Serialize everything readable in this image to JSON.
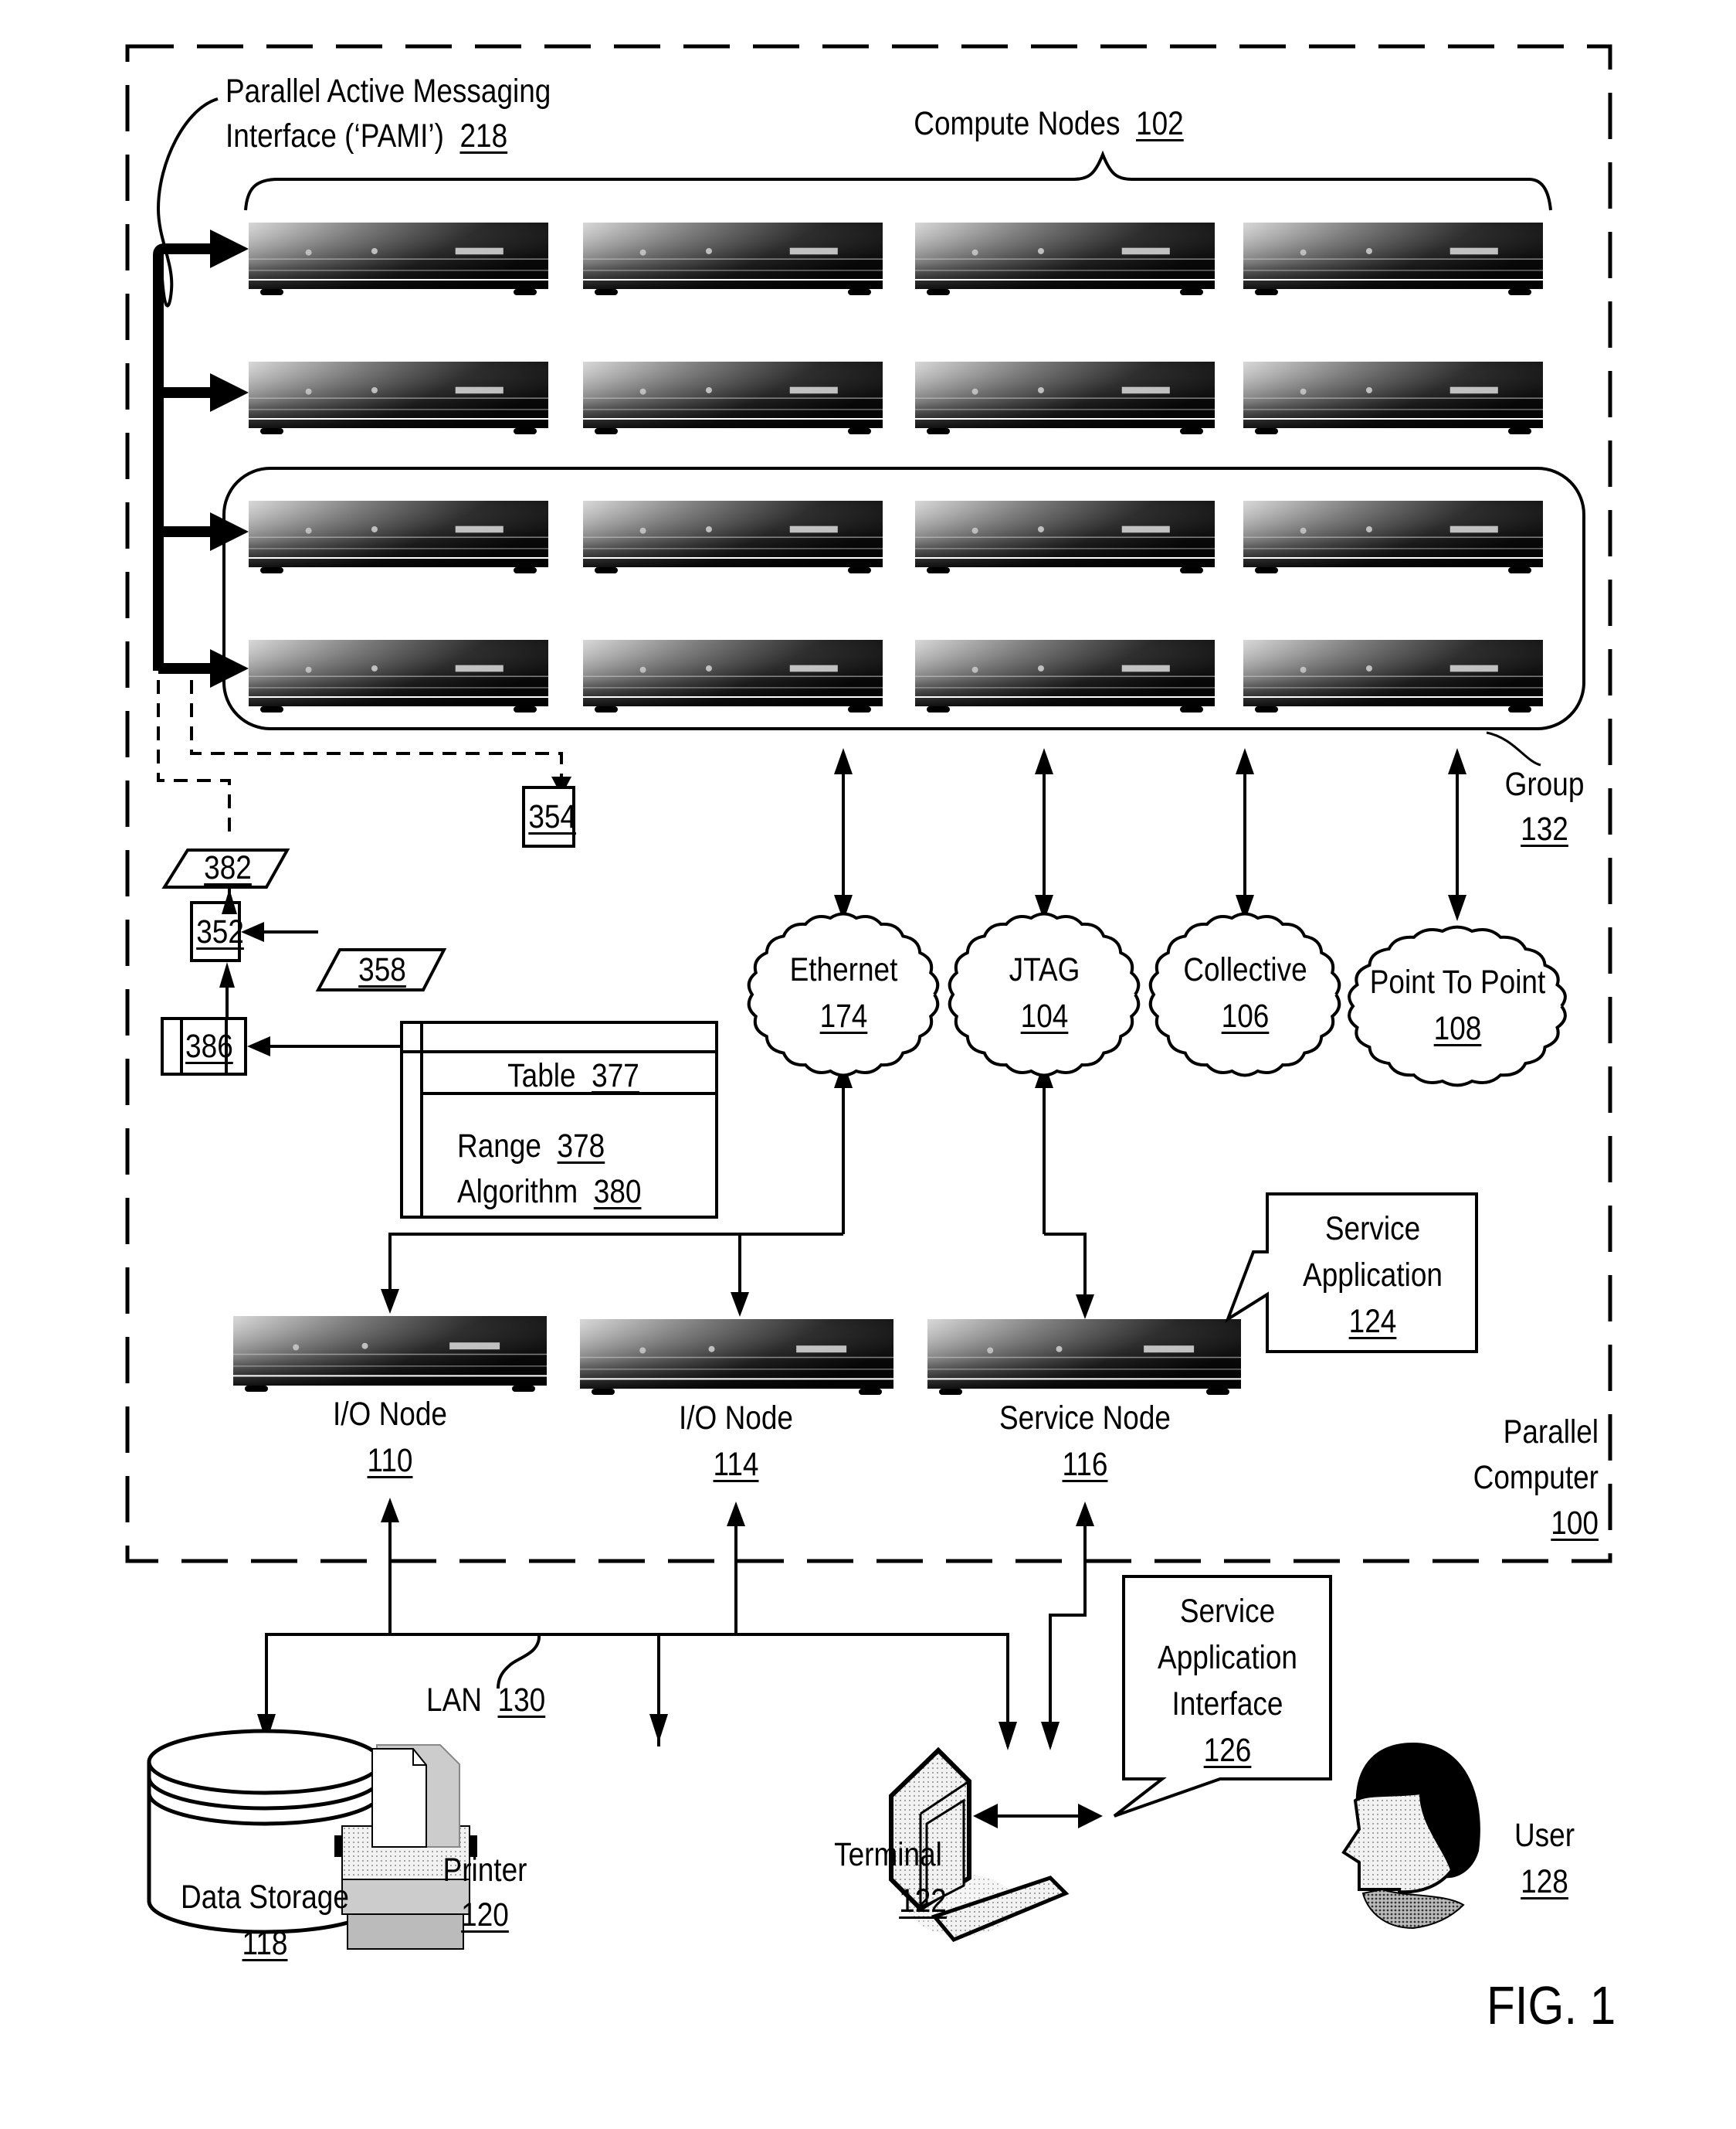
{
  "figure": {
    "label": "FIG. 1"
  },
  "parallel_computer": {
    "name_line1": "Parallel",
    "name_line2": "Computer",
    "ref": "100"
  },
  "pami": {
    "line1": "Parallel Active Messaging",
    "line2": "Interface (‘PAMI’)",
    "ref": "218"
  },
  "compute_nodes": {
    "label": "Compute Nodes",
    "ref": "102",
    "rows": 4,
    "columns": 4
  },
  "group": {
    "label": "Group",
    "ref": "132"
  },
  "networks": [
    {
      "name": "Ethernet",
      "ref": "174"
    },
    {
      "name": "JTAG",
      "ref": "104"
    },
    {
      "name": "Collective",
      "ref": "106"
    },
    {
      "name": "Point To Point",
      "ref": "108"
    }
  ],
  "blocks": {
    "b382": "382",
    "b354": "354",
    "b352": "352",
    "b358": "358",
    "b386": "386"
  },
  "table": {
    "title": "Table",
    "title_ref": "377",
    "rows": [
      {
        "label": "Range",
        "ref": "378"
      },
      {
        "label": "Algorithm",
        "ref": "380"
      }
    ]
  },
  "io_nodes": [
    {
      "label": "I/O Node",
      "ref": "110"
    },
    {
      "label": "I/O Node",
      "ref": "114"
    }
  ],
  "service_node": {
    "label": "Service Node",
    "ref": "116"
  },
  "service_application": {
    "line1": "Service",
    "line2": "Application",
    "ref": "124"
  },
  "lan": {
    "label": "LAN",
    "ref": "130"
  },
  "data_storage": {
    "label": "Data Storage",
    "ref": "118"
  },
  "printer": {
    "label": "Printer",
    "ref": "120"
  },
  "terminal": {
    "label": "Terminal",
    "ref": "122"
  },
  "service_app_interface": {
    "line1": "Service",
    "line2": "Application",
    "line3": "Interface",
    "ref": "126"
  },
  "user": {
    "label": "User",
    "ref": "128"
  }
}
